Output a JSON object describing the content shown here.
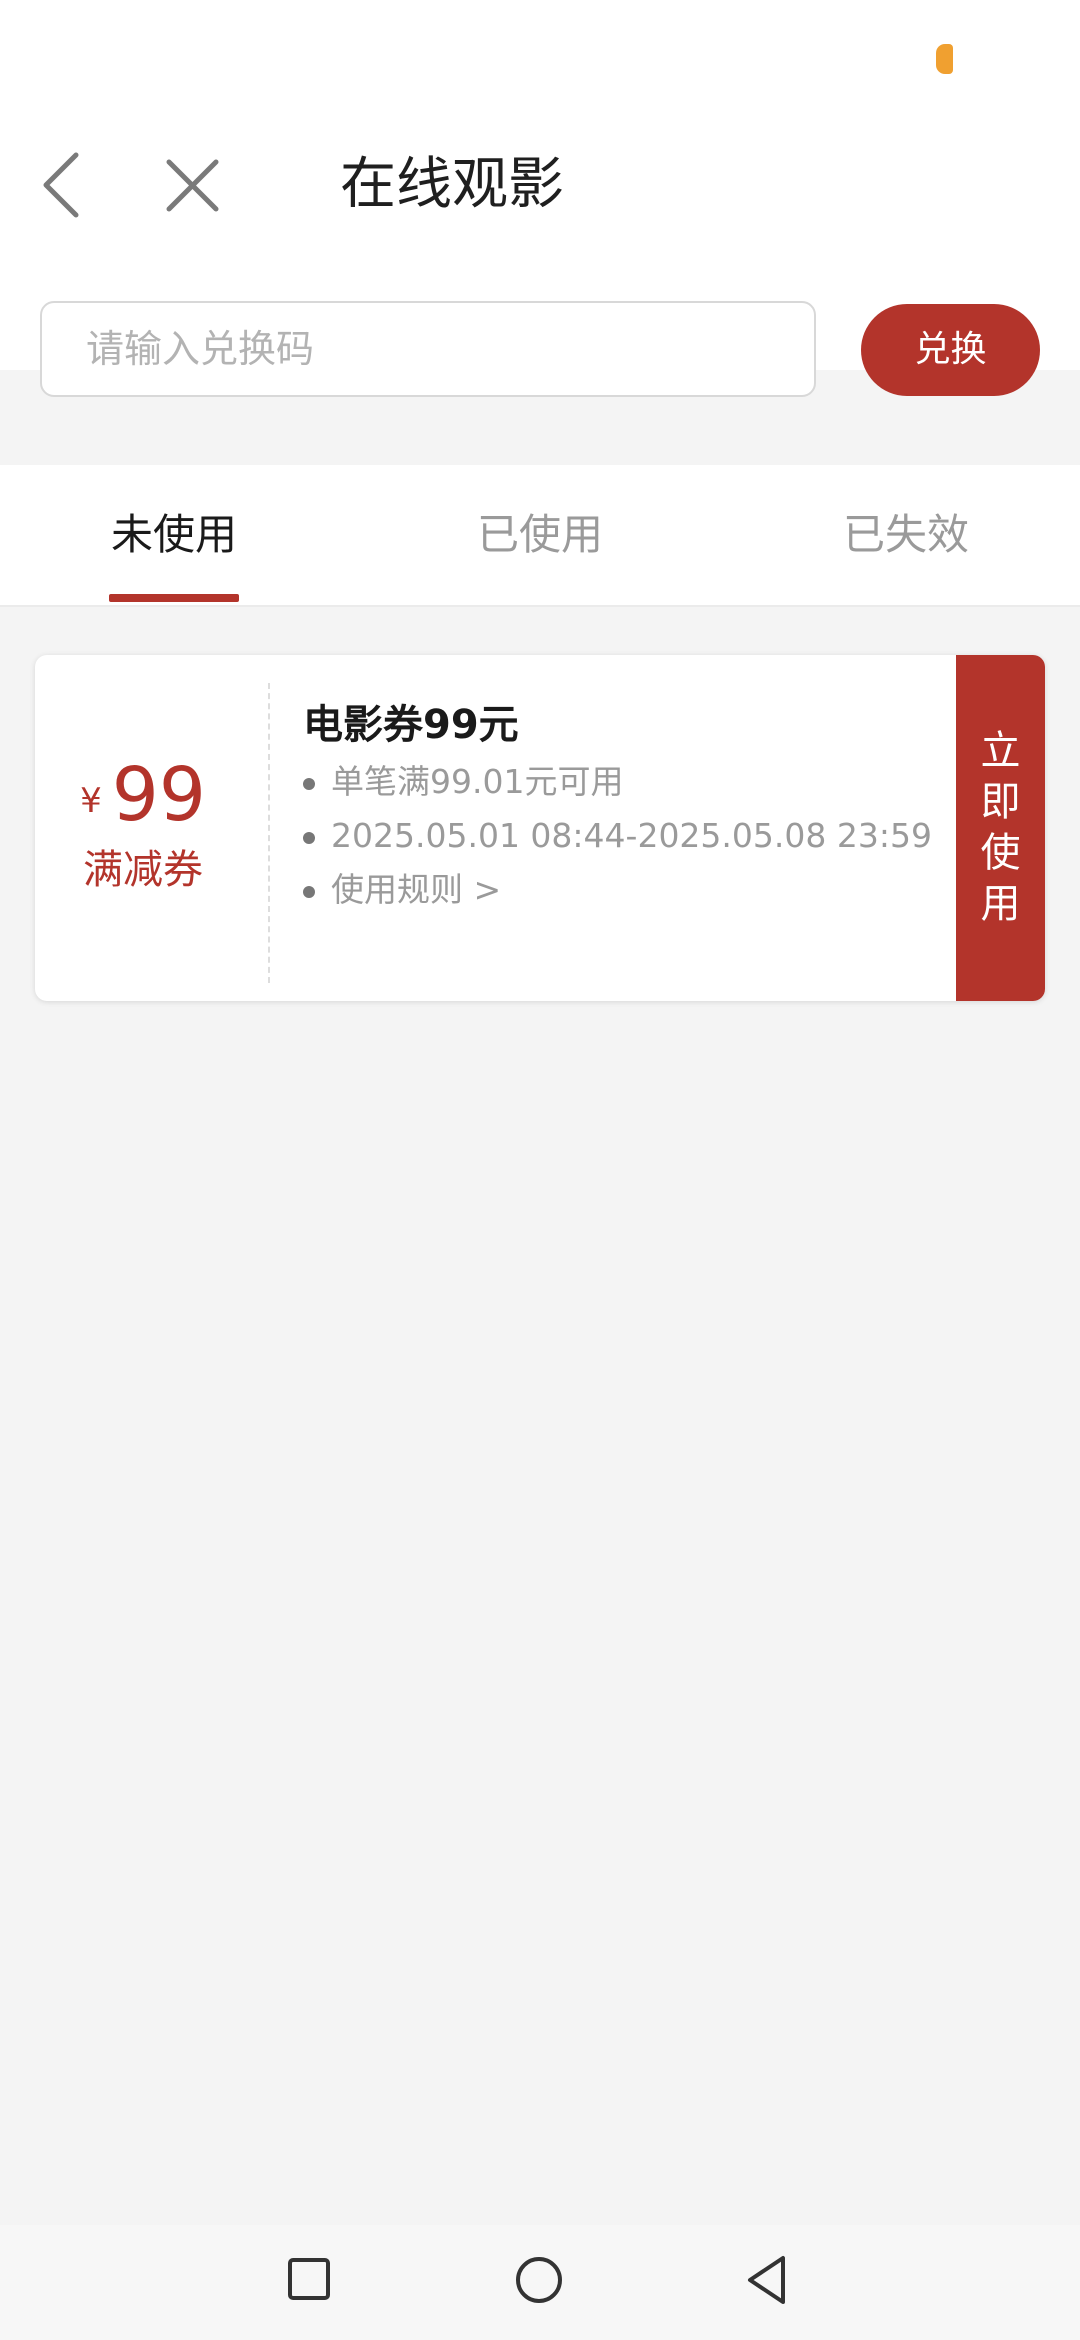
{
  "header": {
    "title": "在线观影"
  },
  "redeem": {
    "placeholder": "请输入兑换码",
    "button_label": "兑换"
  },
  "tabs": [
    {
      "label": "未使用",
      "active": true
    },
    {
      "label": "已使用",
      "active": false
    },
    {
      "label": "已失效",
      "active": false
    }
  ],
  "coupon": {
    "currency": "¥",
    "amount": "99",
    "type_label": "满减券",
    "title": "电影券99元",
    "details": [
      "单笔满99.01元可用",
      "2025.05.01 08:44-2025.05.08 23:59",
      "使用规则 >"
    ],
    "action_label": "立即使用"
  },
  "colors": {
    "accent": "#b3342b",
    "status_indicator": "#f0a030",
    "background": "#f4f4f4"
  },
  "icons": {
    "back": "chevron-left-icon",
    "close": "close-icon",
    "nav_recents": "square-icon",
    "nav_home": "circle-icon",
    "nav_back": "triangle-back-icon"
  }
}
